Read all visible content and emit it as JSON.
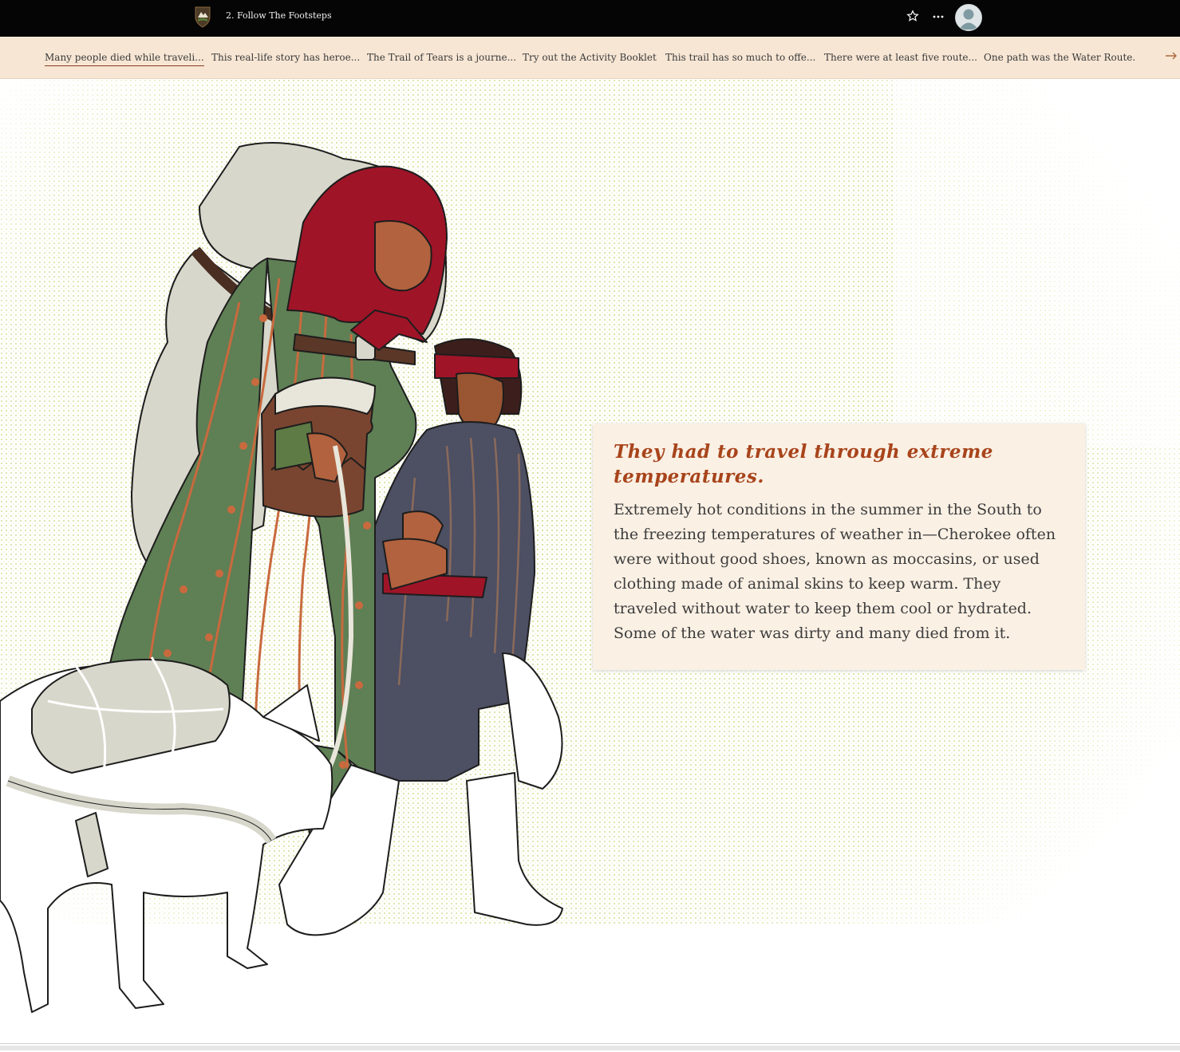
{
  "header": {
    "story_title": "2. Follow The Footsteps",
    "icons": [
      "nps-arrowhead-logo",
      "star-icon",
      "more-icon",
      "avatar"
    ]
  },
  "nav": {
    "items": [
      {
        "label": "Many people died while traveli...",
        "active": true
      },
      {
        "label": "This real-life story has heroe...",
        "active": false
      },
      {
        "label": "The Trail of Tears is a journe...",
        "active": false
      },
      {
        "label": "Try out the Activity Booklet",
        "active": false
      },
      {
        "label": "This trail has so much to offe...",
        "active": false
      },
      {
        "label": "There were at least five route...",
        "active": false
      },
      {
        "label": "One path was the Water Route.",
        "active": false
      }
    ],
    "next_icon": "arrow-right-icon"
  },
  "card": {
    "heading": "They had to travel through extreme temperatures.",
    "body": "Extremely hot conditions in the summer in the South to the freezing temperatures of weather in—Cherokee often were without good shoes, known as moccasins, or used clothing made of animal skins to keep warm. They traveled without water to keep them cool or hydrated. Some of the water was dirty and many died from it."
  },
  "colors": {
    "topbar": "#050505",
    "navbar": "#f7e6d4",
    "heading": "#a8441b",
    "card": "#faf0e4",
    "texture": "#cfdc8a"
  }
}
